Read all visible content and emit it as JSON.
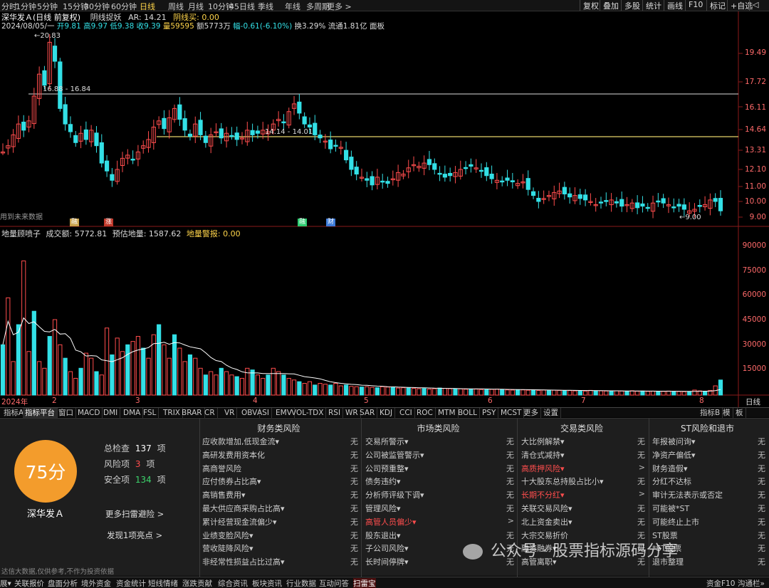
{
  "periods": [
    "分时",
    "1分钟",
    "5分钟",
    "15分钟",
    "30分钟",
    "60分钟",
    "日线",
    "周线",
    "月线",
    "10分钟",
    "45日线",
    "季线",
    "年线",
    "多周期",
    "更多 >"
  ],
  "active_period": "日线",
  "right_buttons": [
    "复权",
    "叠加",
    "多股",
    "统计",
    "画线",
    "F10",
    "标记",
    "+自选",
    "◁"
  ],
  "stock": {
    "title": "深华发Ａ(日线 前复权)",
    "indicator_name": "阴线捉妖",
    "ar": "AR: 14.21",
    "yin_buy": "阴线买: 0.00",
    "date": "2024/08/05/一",
    "open": "开9.81",
    "high": "高9.97",
    "low": "低9.38",
    "close": "收9.39",
    "volume": "量59595",
    "amount": "额5773万",
    "change": "幅-0.61(-6.10%)",
    "turnover": "换3.29%",
    "float": "流通1.81亿",
    "board": "面板"
  },
  "price_axis": [
    "19.49",
    "17.72",
    "16.11",
    "14.64",
    "13.31",
    "12.10",
    "11.00",
    "10.00",
    "9.00"
  ],
  "vol_axis": [
    "90000",
    "75000",
    "60000",
    "45000",
    "30000",
    "15000"
  ],
  "annotations": {
    "high_label": "20.83",
    "low_label": "9.00",
    "line1": "16.88 - 16.84",
    "line2": "14.14 - 14.01",
    "future_text": "用到未来数据"
  },
  "badges": [
    "融",
    "涨",
    "融",
    "财"
  ],
  "vol_info": {
    "name": "地量顾喷子",
    "amount": "成交额: 5772.81",
    "estimate": "预估地量: 1587.62",
    "warn": "地量警报: 0.00"
  },
  "x_axis": [
    "2024年",
    "2",
    "3",
    "4",
    "5",
    "6",
    "7",
    "8"
  ],
  "x_axis_right": "日线",
  "indicator_tabs": [
    "指标A",
    "指标平台",
    "窗口",
    "MACD",
    "DMI",
    "DMA",
    "FSL",
    "TRIX",
    "BRAR",
    "CR",
    "VR",
    "OBV",
    "ASI",
    "EMV",
    "VOL-TDX",
    "RSI",
    "WR",
    "SAR",
    "KDJ",
    "CCI",
    "ROC",
    "MTM",
    "BOLL",
    "PSY",
    "MCST",
    "更多",
    "设置"
  ],
  "indicator_tabs_right": [
    "指标B",
    "模",
    "板"
  ],
  "score": {
    "value": "75分",
    "total_label": "总检查",
    "total": "137",
    "risk_label": "风险项",
    "risk": "3",
    "safe_label": "安全项",
    "safe": "134",
    "unit": "项",
    "stock_name": "深华发Ａ",
    "more": "更多扫雷避险 >",
    "bright": "发现1项亮点 >",
    "disclaimer": "达信大数据,仅供参考,不作为投资依据"
  },
  "risk_columns": [
    {
      "title": "财务类风险",
      "items": [
        {
          "label": "应收款增加,低现金流▾",
          "val": "无"
        },
        {
          "label": "高研发费用资本化",
          "val": "无"
        },
        {
          "label": "高商誉风险",
          "val": "无"
        },
        {
          "label": "应付债券占比高▾",
          "val": "无"
        },
        {
          "label": "高销售费用▾",
          "val": "无"
        },
        {
          "label": "最大供应商采购占比高▾",
          "val": "无"
        },
        {
          "label": "累计经营现金流偏少▾",
          "val": "无"
        },
        {
          "label": "业绩变脸风险▾",
          "val": "无"
        },
        {
          "label": "营收陡降风险▾",
          "val": "无"
        },
        {
          "label": "非经常性损益占比过高▾",
          "val": "无"
        }
      ]
    },
    {
      "title": "市场类风险",
      "items": [
        {
          "label": "交易所警示▾",
          "val": "无"
        },
        {
          "label": "公司被监管警示▾",
          "val": "无"
        },
        {
          "label": "公司预重整▾",
          "val": "无"
        },
        {
          "label": "债务违约▾",
          "val": "无"
        },
        {
          "label": "分析师评级下调▾",
          "val": "无"
        },
        {
          "label": "管理风险▾",
          "val": "无"
        },
        {
          "label": "高管人员偏少▾",
          "val": ">",
          "red": true
        },
        {
          "label": "股东退出▾",
          "val": "无"
        },
        {
          "label": "子公司风险▾",
          "val": "无"
        },
        {
          "label": "长时间停牌▾",
          "val": "无"
        }
      ]
    },
    {
      "title": "交易类风险",
      "items": [
        {
          "label": "大比例解禁▾",
          "val": "无"
        },
        {
          "label": "清仓式减持▾",
          "val": "无"
        },
        {
          "label": "高质押风险▾",
          "val": ">",
          "red": true
        },
        {
          "label": "十大股东总持股占比小▾",
          "val": "无"
        },
        {
          "label": "长期不分红▾",
          "val": ">",
          "red": true
        },
        {
          "label": "关联交易风险▾",
          "val": "无"
        },
        {
          "label": "北上资金卖出▾",
          "val": "无"
        },
        {
          "label": "大宗交易折价",
          "val": "无"
        },
        {
          "label": "融资融券▾",
          "val": "无"
        },
        {
          "label": "高管离职▾",
          "val": "无"
        }
      ]
    },
    {
      "title": "ST风险和退市",
      "items": [
        {
          "label": "年报被问询▾",
          "val": "无"
        },
        {
          "label": "净资产偏低▾",
          "val": "无"
        },
        {
          "label": "财务造假▾",
          "val": "无"
        },
        {
          "label": "分红不达标",
          "val": "无"
        },
        {
          "label": "审计无法表示或否定",
          "val": "无"
        },
        {
          "label": "可能被*ST",
          "val": "无"
        },
        {
          "label": "可能终止上市",
          "val": "无"
        },
        {
          "label": "ST股票",
          "val": "无"
        },
        {
          "label": "*ST股票",
          "val": "无"
        },
        {
          "label": "退市整理",
          "val": "无"
        }
      ]
    }
  ],
  "watermark": "公众号 · 股票指标源码分享",
  "status_tabs": [
    "展▾",
    "关联报价",
    "盘面分析",
    "境外资金",
    "资金统计",
    "短线情绪",
    "涨跌贡献",
    "综合资讯",
    "板块资讯",
    "行业数据",
    "互动问答",
    "扫雷宝"
  ],
  "status_right": "资金F10",
  "status_right2": "沟通栏»",
  "colors": {
    "up": "#ff4d4d",
    "down": "#33e0e6",
    "accent": "#f39c2c",
    "active": "#ffd54a"
  }
}
